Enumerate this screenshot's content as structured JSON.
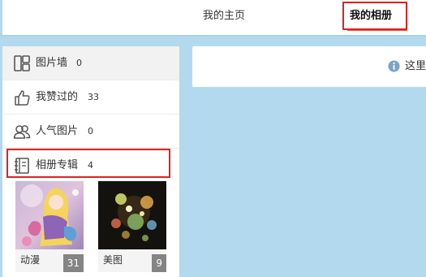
{
  "header": {
    "tabs": [
      {
        "label": "我的主页"
      },
      {
        "label": "我的相册",
        "active": true
      }
    ],
    "accent_color": "#e8563a"
  },
  "sidebar": {
    "items": [
      {
        "label": "图片墙",
        "count": "0",
        "icon": "grid-icon",
        "active": true
      },
      {
        "label": "我赞过的",
        "count": "33",
        "icon": "thumbs-up-icon"
      },
      {
        "label": "人气图片",
        "count": "0",
        "icon": "users-icon"
      },
      {
        "label": "相册专辑",
        "count": "4",
        "icon": "notebook-icon"
      }
    ],
    "albums": [
      {
        "name": "动漫",
        "count": "31"
      },
      {
        "name": "美图",
        "count": "9"
      }
    ]
  },
  "notice": {
    "text": "这里",
    "icon": "info-icon"
  },
  "annotation_color": "#e02020",
  "background_color": "#b3d9ee"
}
